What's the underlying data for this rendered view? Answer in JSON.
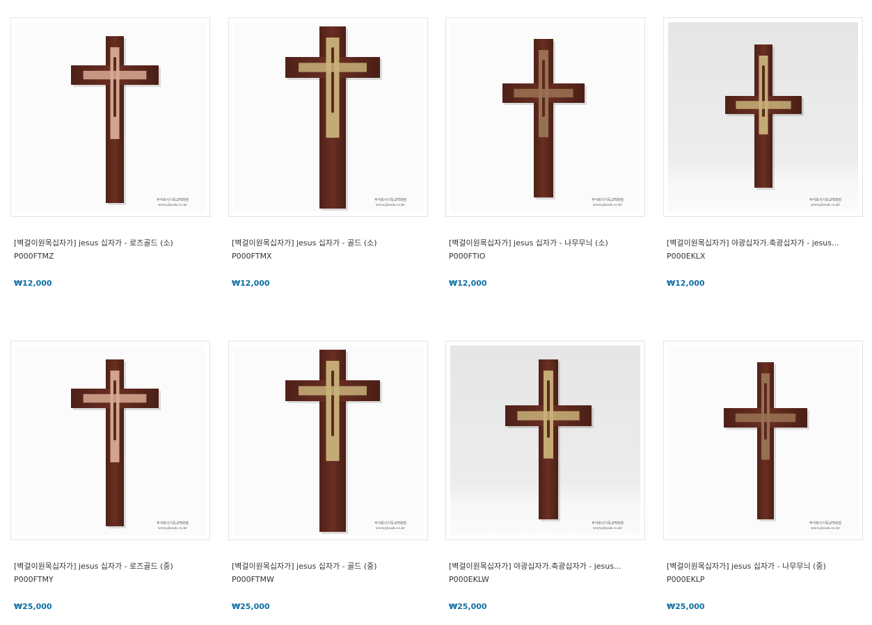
{
  "colors": {
    "price": "#0f6fa4",
    "text": "#333333",
    "border": "#e4e4e4",
    "wood": "#6b2f22",
    "gold": "#c9b27a",
    "rosegold": "#d8aa93",
    "natural": "#9a7354"
  },
  "watermark": {
    "line1": "주식회사기독교백화점",
    "line2": "www.jbook.co.kr"
  },
  "products": [
    {
      "name": "[벽걸이원목십자가] jesus 십자가 - 로즈골드 (소)",
      "code": "P000FTMZ",
      "price": "₩12,000",
      "image": "cross-rosegold-icon"
    },
    {
      "name": "[벽걸이원목십자가] jesus 십자가 - 골드 (소)",
      "code": "P000FTMX",
      "price": "₩12,000",
      "image": "cross-gold-icon"
    },
    {
      "name": "[벽걸이원목십자가] jesus 십자가 - 나무무늬 (소)",
      "code": "P000FTIO",
      "price": "₩12,000",
      "image": "cross-wood-icon"
    },
    {
      "name": "[벽걸이원목십자가] 야광십자가.축광십자가 - jesus...",
      "code": "P000EKLX",
      "price": "₩12,000",
      "image": "cross-glow-icon"
    },
    {
      "name": "[벽걸이원목십자가] jesus 십자가 - 로즈골드 (중)",
      "code": "P000FTMY",
      "price": "₩25,000",
      "image": "cross-rosegold-icon"
    },
    {
      "name": "[벽걸이원목십자가] jesus 십자가 - 골드 (중)",
      "code": "P000FTMW",
      "price": "₩25,000",
      "image": "cross-gold-icon"
    },
    {
      "name": "[벽걸이원목십자가] 야광십자가.축광십자가 - jesus...",
      "code": "P000EKLW",
      "price": "₩25,000",
      "image": "cross-glow-icon"
    },
    {
      "name": "[벽걸이원목십자가] jesus 십자가 - 나무무늬 (중)",
      "code": "P000EKLP",
      "price": "₩25,000",
      "image": "cross-wood-icon"
    }
  ]
}
